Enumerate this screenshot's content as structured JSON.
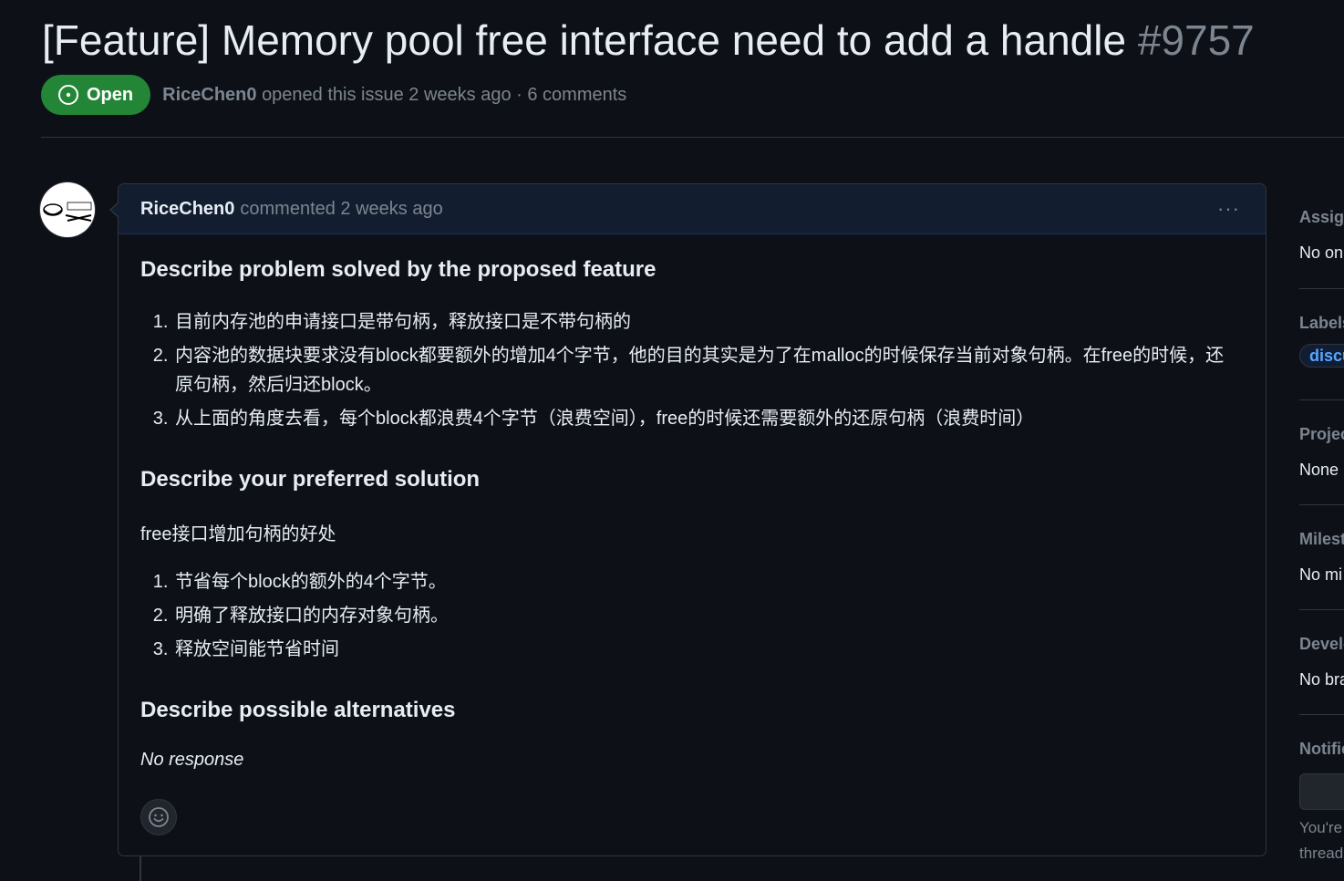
{
  "issue": {
    "title": "[Feature] Memory pool free interface need to add a handle",
    "number": "#9757",
    "state": "Open",
    "author": "RiceChen0",
    "meta": "opened this issue 2 weeks ago · 6 comments"
  },
  "comment": {
    "author": "RiceChen0",
    "time": "commented 2 weeks ago",
    "menu": "···",
    "sections": {
      "problem_heading": "Describe problem solved by the proposed feature",
      "problem_items": [
        "目前内存池的申请接口是带句柄，释放接口是不带句柄的",
        "内容池的数据块要求没有block都要额外的增加4个字节，他的目的其实是为了在malloc的时候保存当前对象句柄。在free的时候，还原句柄，然后归还block。",
        "从上面的角度去看，每个block都浪费4个字节（浪费空间），free的时候还需要额外的还原句柄（浪费时间）"
      ],
      "solution_heading": "Describe your preferred solution",
      "solution_text": "free接口增加句柄的好处",
      "solution_items": [
        "节省每个block的额外的4个字节。",
        "明确了释放接口的内存对象句柄。",
        "释放空间能节省时间"
      ],
      "alt_heading": "Describe possible alternatives",
      "alt_text": "No response"
    }
  },
  "sidebar": {
    "assignees": {
      "heading": "Assign",
      "value": "No on"
    },
    "labels": {
      "heading": "Labels",
      "value": "discu"
    },
    "projects": {
      "heading": "Projec",
      "value": "None"
    },
    "milestone": {
      "heading": "Milest",
      "value": "No mi"
    },
    "development": {
      "heading": "Develo",
      "value": "No bra"
    },
    "notifications": {
      "heading": "Notific",
      "line1": "You're",
      "line2": "thread"
    }
  },
  "colors": {
    "open_green": "#238636",
    "background": "#0d1117",
    "accent": "#58a6ff"
  }
}
